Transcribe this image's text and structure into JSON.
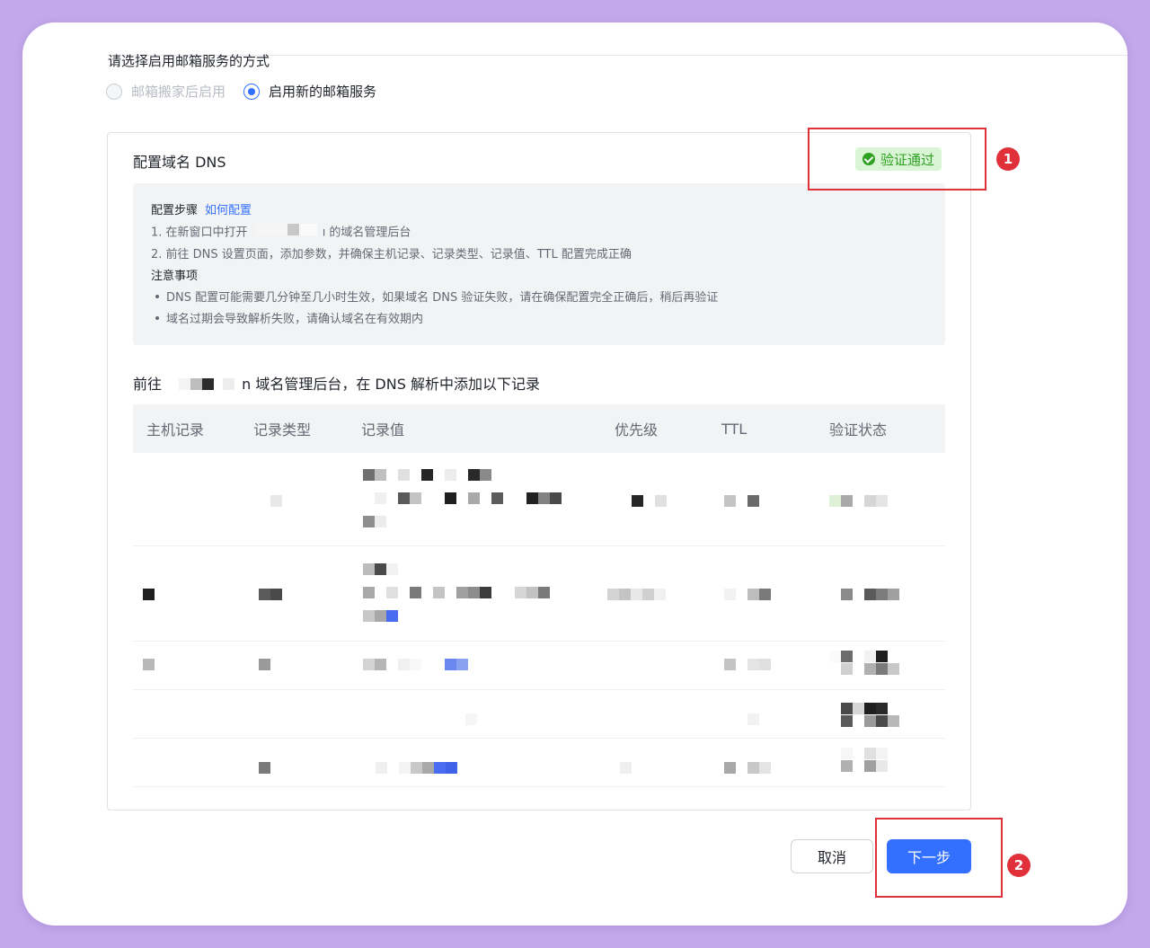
{
  "form": {
    "question": "请选择启用邮箱服务的方式",
    "options": [
      {
        "label": "邮箱搬家后启用",
        "selected": false,
        "disabled": true
      },
      {
        "label": "启用新的邮箱服务",
        "selected": true,
        "disabled": false
      }
    ]
  },
  "dns_panel": {
    "title": "配置域名 DNS",
    "status_badge": "验证通过",
    "guide": {
      "steps_title": "配置步骤",
      "how_link": "如何配置",
      "step1_prefix": "1. 在新窗口中打开",
      "step1_suffix": "ı 的域名管理后台",
      "step2": "2. 前往 DNS 设置页面，添加参数，并确保主机记录、记录类型、记录值、TTL 配置完成正确",
      "notes_title": "注意事项",
      "note1": "DNS 配置可能需要几分钟至几小时生效，如果域名 DNS 验证失败，请在确保配置完全正确后，稍后再验证",
      "note2": "域名过期会导致解析失败，请确认域名在有效期内"
    },
    "destination_prefix": "前往",
    "destination_suffix": "n 域名管理后台，在 DNS 解析中添加以下记录",
    "table": {
      "headers": [
        "主机记录",
        "记录类型",
        "记录值",
        "优先级",
        "TTL",
        "验证状态"
      ]
    }
  },
  "annotations": [
    "1",
    "2"
  ],
  "footer": {
    "cancel_label": "取消",
    "next_label": "下一步"
  },
  "colors": {
    "accent": "#3370ff",
    "success": "#2ea121",
    "annotation": "#e0313b",
    "background": "#c4a8ec"
  }
}
